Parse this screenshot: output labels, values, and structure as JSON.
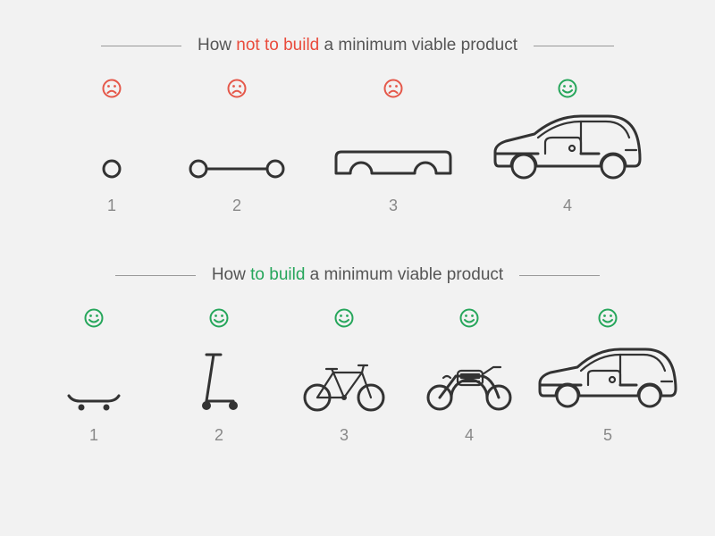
{
  "top": {
    "title_pre": "How ",
    "title_hl": "not to build",
    "title_post": " a minimum viable product",
    "steps": [
      {
        "n": "1",
        "mood": "sad",
        "icon": "wheel"
      },
      {
        "n": "2",
        "mood": "sad",
        "icon": "axle"
      },
      {
        "n": "3",
        "mood": "sad",
        "icon": "chassis"
      },
      {
        "n": "4",
        "mood": "happy",
        "icon": "car"
      }
    ]
  },
  "bottom": {
    "title_pre": "How ",
    "title_hl": "to build",
    "title_post": " a minimum viable product",
    "steps": [
      {
        "n": "1",
        "mood": "happy",
        "icon": "skateboard"
      },
      {
        "n": "2",
        "mood": "happy",
        "icon": "scooter"
      },
      {
        "n": "3",
        "mood": "happy",
        "icon": "bicycle"
      },
      {
        "n": "4",
        "mood": "happy",
        "icon": "motorcycle"
      },
      {
        "n": "5",
        "mood": "happy",
        "icon": "car"
      }
    ]
  },
  "colors": {
    "sad": "#e5584a",
    "happy": "#26a65b"
  }
}
